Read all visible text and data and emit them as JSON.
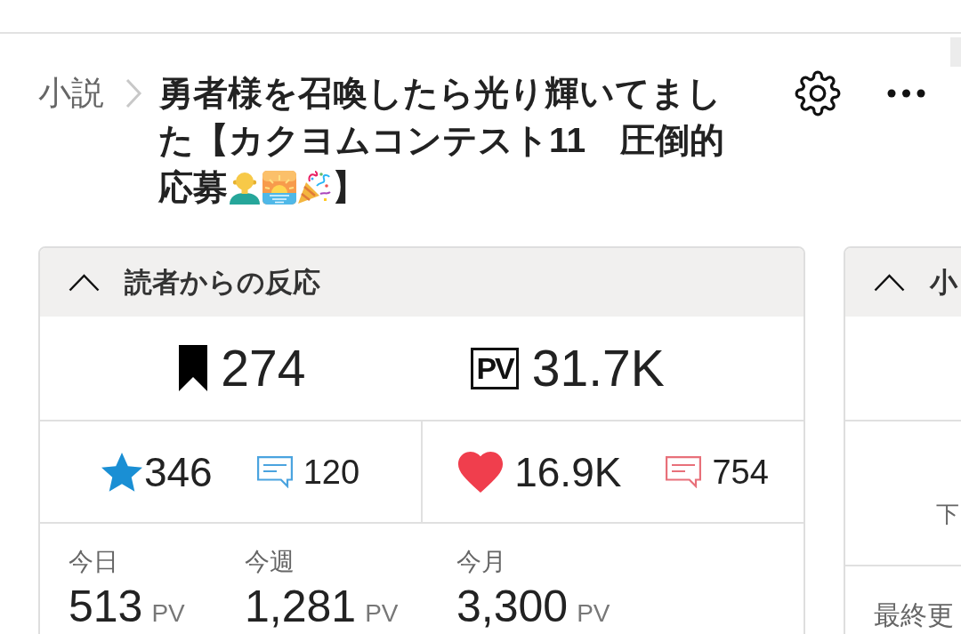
{
  "breadcrumb": "小説",
  "title": {
    "parts": [
      "勇者様を召喚したら光り輝いてました【カクヨムコンテスト11　圧倒的",
      "応募"
    ],
    "end": "】"
  },
  "reader_panel": {
    "title": "読者からの反応",
    "expanded": true,
    "totals": [
      {
        "kind": "bookmarks",
        "value": "274"
      },
      {
        "kind": "pv",
        "badge": "PV",
        "value": "31.7K"
      }
    ],
    "reactions": [
      {
        "kind": "stars",
        "count": "346",
        "comments": "120"
      },
      {
        "kind": "hearts",
        "count": "16.9K",
        "comments": "754"
      }
    ],
    "page_views": [
      {
        "label": "今日",
        "value": "513",
        "unit": "PV"
      },
      {
        "label": "今週",
        "value": "1,281",
        "unit": "PV"
      },
      {
        "label": "今月",
        "value": "3,300",
        "unit": "PV"
      }
    ]
  },
  "panel_2": {
    "title": "小",
    "expanded": true,
    "rows": [
      "下",
      "最終更"
    ]
  }
}
